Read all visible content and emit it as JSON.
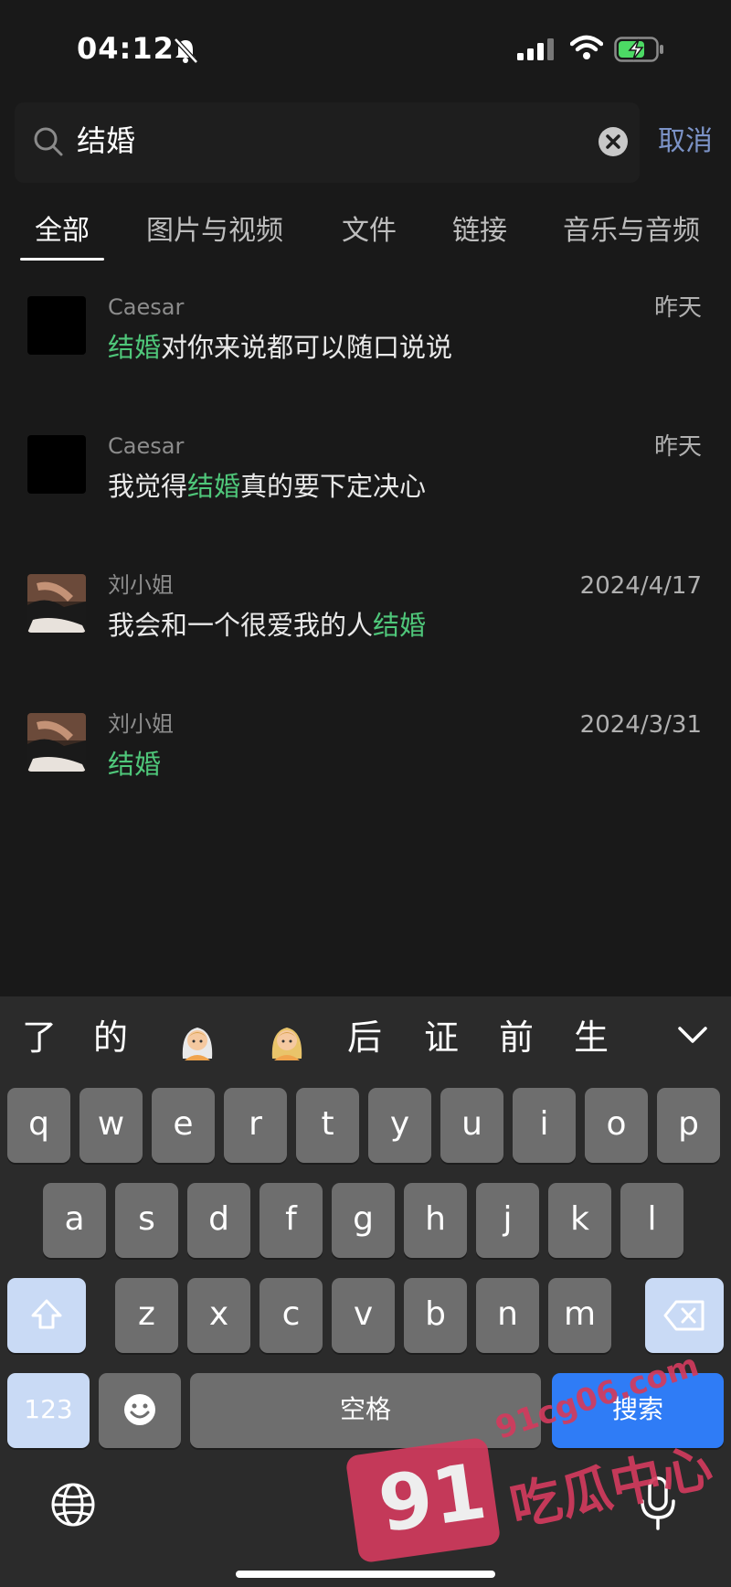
{
  "status_bar": {
    "time": "04:12"
  },
  "search": {
    "query": "结婚",
    "cancel_label": "取消"
  },
  "tabs": [
    {
      "label": "全部",
      "active": true
    },
    {
      "label": "图片与视频"
    },
    {
      "label": "文件"
    },
    {
      "label": "链接"
    },
    {
      "label": "音乐与音频"
    }
  ],
  "results": [
    {
      "sender": "Caesar",
      "date": "昨天",
      "msg_pre": "",
      "msg_hl": "结婚",
      "msg_post": "对你来说都可以随口说说"
    },
    {
      "sender": "Caesar",
      "date": "昨天",
      "msg_pre": "我觉得",
      "msg_hl": "结婚",
      "msg_post": "真的要下定决心"
    },
    {
      "sender": "刘小姐",
      "date": "2024/4/17",
      "msg_pre": "我会和一个很爱我的人",
      "msg_hl": "结婚",
      "msg_post": ""
    },
    {
      "sender": "刘小姐",
      "date": "2024/3/31",
      "msg_pre": "",
      "msg_hl": "结婚",
      "msg_post": ""
    }
  ],
  "keyboard": {
    "candidates": [
      "了",
      "的",
      "后",
      "证",
      "前",
      "生"
    ],
    "row1": [
      "q",
      "w",
      "e",
      "r",
      "t",
      "y",
      "u",
      "i",
      "o",
      "p"
    ],
    "row2": [
      "a",
      "s",
      "d",
      "f",
      "g",
      "h",
      "j",
      "k",
      "l"
    ],
    "row3": [
      "z",
      "x",
      "c",
      "v",
      "b",
      "n",
      "m"
    ],
    "numbers_label": "123",
    "space_label": "空格",
    "search_label": "搜索"
  },
  "watermark": {
    "badge": "91",
    "url": "91cg06.com",
    "name": "吃瓜中心"
  },
  "colors": {
    "highlight": "#4fc77a",
    "accent": "#7c93c7",
    "search_key": "#2f7cf6"
  }
}
